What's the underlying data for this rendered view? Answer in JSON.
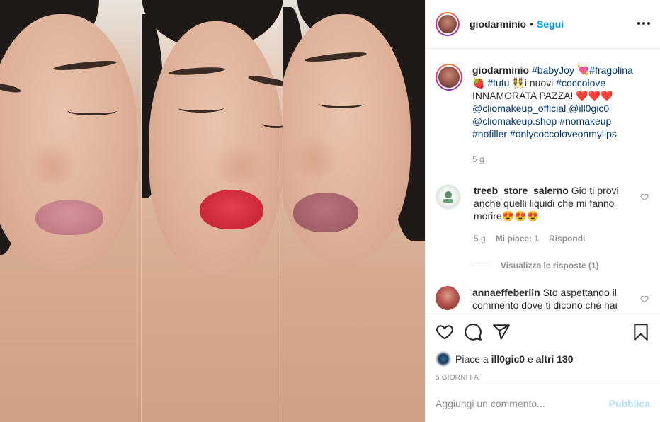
{
  "header": {
    "username": "giodarminio",
    "separator": "•",
    "follow_label": "Segui"
  },
  "caption": {
    "username": "giodarminio",
    "tokens": [
      {
        "text": "#babyJoy",
        "tag": true
      },
      {
        "text": " 💘",
        "tag": false
      },
      {
        "text": "#fragolina",
        "tag": true
      },
      {
        "text": " 🍓 ",
        "tag": false
      },
      {
        "text": "#tutu",
        "tag": true
      },
      {
        "text": " 👯i nuovi ",
        "tag": false
      },
      {
        "text": "#coccolove",
        "tag": true
      },
      {
        "text": " INNAMORATA PAZZA! ❤️❤️❤️ ",
        "tag": false
      },
      {
        "text": "@cliomakeup_official",
        "tag": true
      },
      {
        "text": " ",
        "tag": false
      },
      {
        "text": "@ill0gic0",
        "tag": true
      },
      {
        "text": " ",
        "tag": false
      },
      {
        "text": "@cliomakeup.shop",
        "tag": true
      },
      {
        "text": " ",
        "tag": false
      },
      {
        "text": "#nomakeup",
        "tag": true
      },
      {
        "text": " ",
        "tag": false
      },
      {
        "text": "#nofiller",
        "tag": true
      },
      {
        "text": " ",
        "tag": false
      },
      {
        "text": "#onlycoccoloveonmylips",
        "tag": true
      }
    ],
    "time": "5 g"
  },
  "comments": [
    {
      "username": "treeb_store_salerno",
      "text": "Gio ti provi anche quelli liquidi che mi fanno morire😍😍😍",
      "time": "5 g",
      "likes": "Mi piace: 1",
      "reply_label": "Rispondi",
      "view_replies": "Visualizza le risposte (1)"
    },
    {
      "username": "annaeffeberlin",
      "text": "Sto aspettando il commento dove ti dicono che hai"
    }
  ],
  "actions": {
    "liked_by_prefix": "Piace a ",
    "liked_by_user": "ill0gic0",
    "liked_by_middle": " e ",
    "liked_by_others": "altri 130",
    "time_ago": "5 GIORNI FA"
  },
  "composer": {
    "placeholder": "Aggiungi un commento...",
    "publish_label": "Pubblica"
  },
  "icons": [
    "more-options-icon",
    "heart-icon",
    "comment-icon",
    "share-icon",
    "bookmark-icon",
    "small-heart-icon"
  ],
  "colors": {
    "link_blue": "#0095f6",
    "hashtag": "#00376b",
    "muted": "#8e8e8e",
    "publish_disabled": "#b2dffc"
  }
}
